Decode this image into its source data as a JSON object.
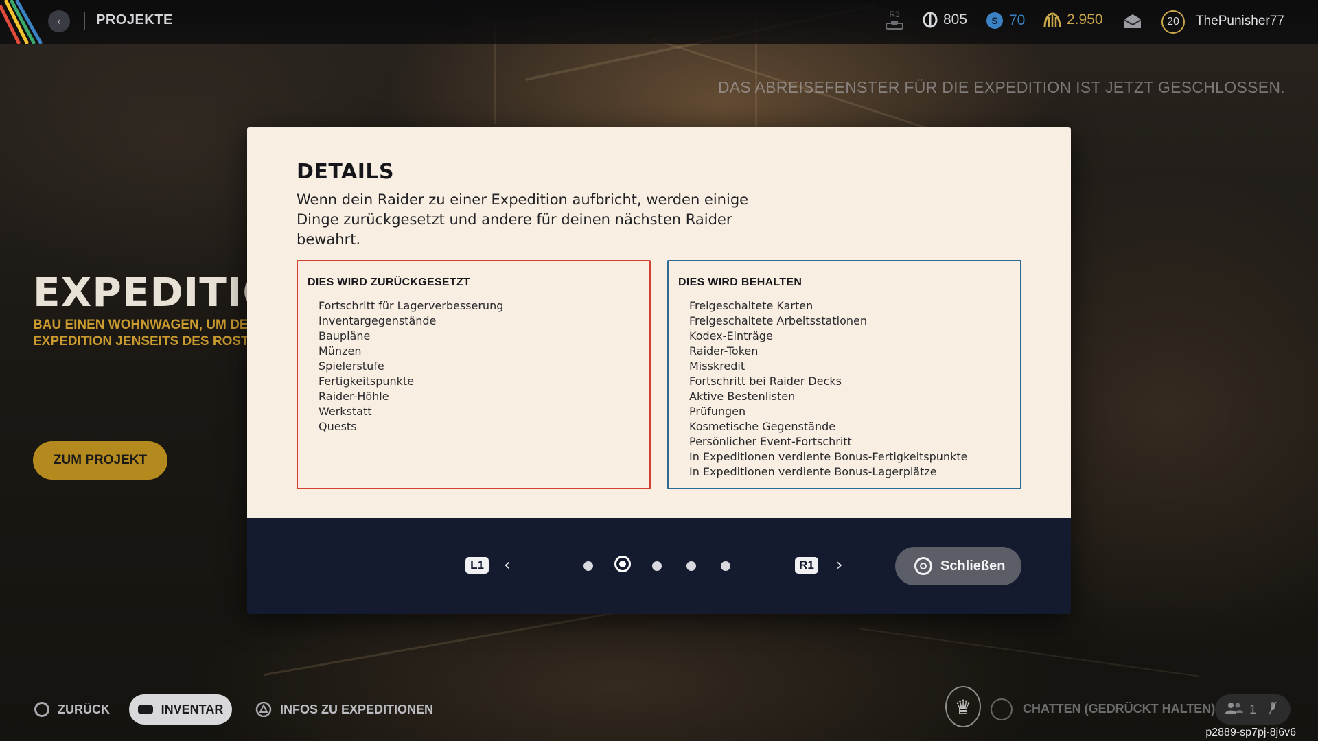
{
  "topbar": {
    "section_title": "PROJEKTE",
    "r3_label": "R3",
    "currencies": [
      {
        "icon": "coin-icon",
        "value": "805",
        "color": "#d8d8dc"
      },
      {
        "icon": "token-icon",
        "value": "70",
        "color": "#3b82c4"
      },
      {
        "icon": "crest-icon",
        "value": "2.950",
        "color": "#c9a64a"
      }
    ],
    "level": "20",
    "username": "ThePunisher77"
  },
  "notice": "DAS ABREISEFENSTER FÜR DIE EXPEDITION IST JETZT GESCHLOSSEN.",
  "background": {
    "title": "EXPEDITION",
    "subtitle": "BAU EINEN WOHNWAGEN, UM DEI EXPEDITION JENSEITS DES ROSTG",
    "project_button": "ZUM PROJEKT"
  },
  "modal": {
    "title": "DETAILS",
    "description": "Wenn dein Raider zu einer Expedition aufbricht, werden einige Dinge zurückgesetzt und andere für deinen nächsten Raider bewahrt.",
    "reset_box": {
      "title": "DIES WIRD ZURÜCKGESETZT",
      "items": [
        "Fortschritt für Lagerverbesserung",
        "Inventargegenstände",
        "Baupläne",
        "Münzen",
        "Spielerstufe",
        "Fertigkeitspunkte",
        "Raider-Höhle",
        "Werkstatt",
        "Quests"
      ]
    },
    "keep_box": {
      "title": "DIES WIRD BEHALTEN",
      "items": [
        "Freigeschaltete Karten",
        "Freigeschaltete Arbeitsstationen",
        "Kodex-Einträge",
        "Raider-Token",
        "Misskredit",
        "Fortschritt bei Raider Decks",
        "Aktive Bestenlisten",
        "Prüfungen",
        "Kosmetische Gegenstände",
        "Persönlicher Event-Fortschritt",
        "In Expeditionen verdiente Bonus-Fertigkeitspunkte",
        "In Expeditionen verdiente Bonus-Lagerplätze"
      ]
    },
    "nav": {
      "prev_glyph": "L1",
      "next_glyph": "R1",
      "page_count": 5,
      "active_page": 2
    },
    "close_label": "Schließen"
  },
  "bottom_bar": {
    "back_label": "ZURÜCK",
    "inventory_label": "INVENTAR",
    "info_label": "INFOS ZU EXPEDITIONEN",
    "chat_label": "CHATTEN (GEDRÜCKT HALTEN)",
    "party_count": "1"
  },
  "build_id": "p2889-sp7pj-8j6v6"
}
